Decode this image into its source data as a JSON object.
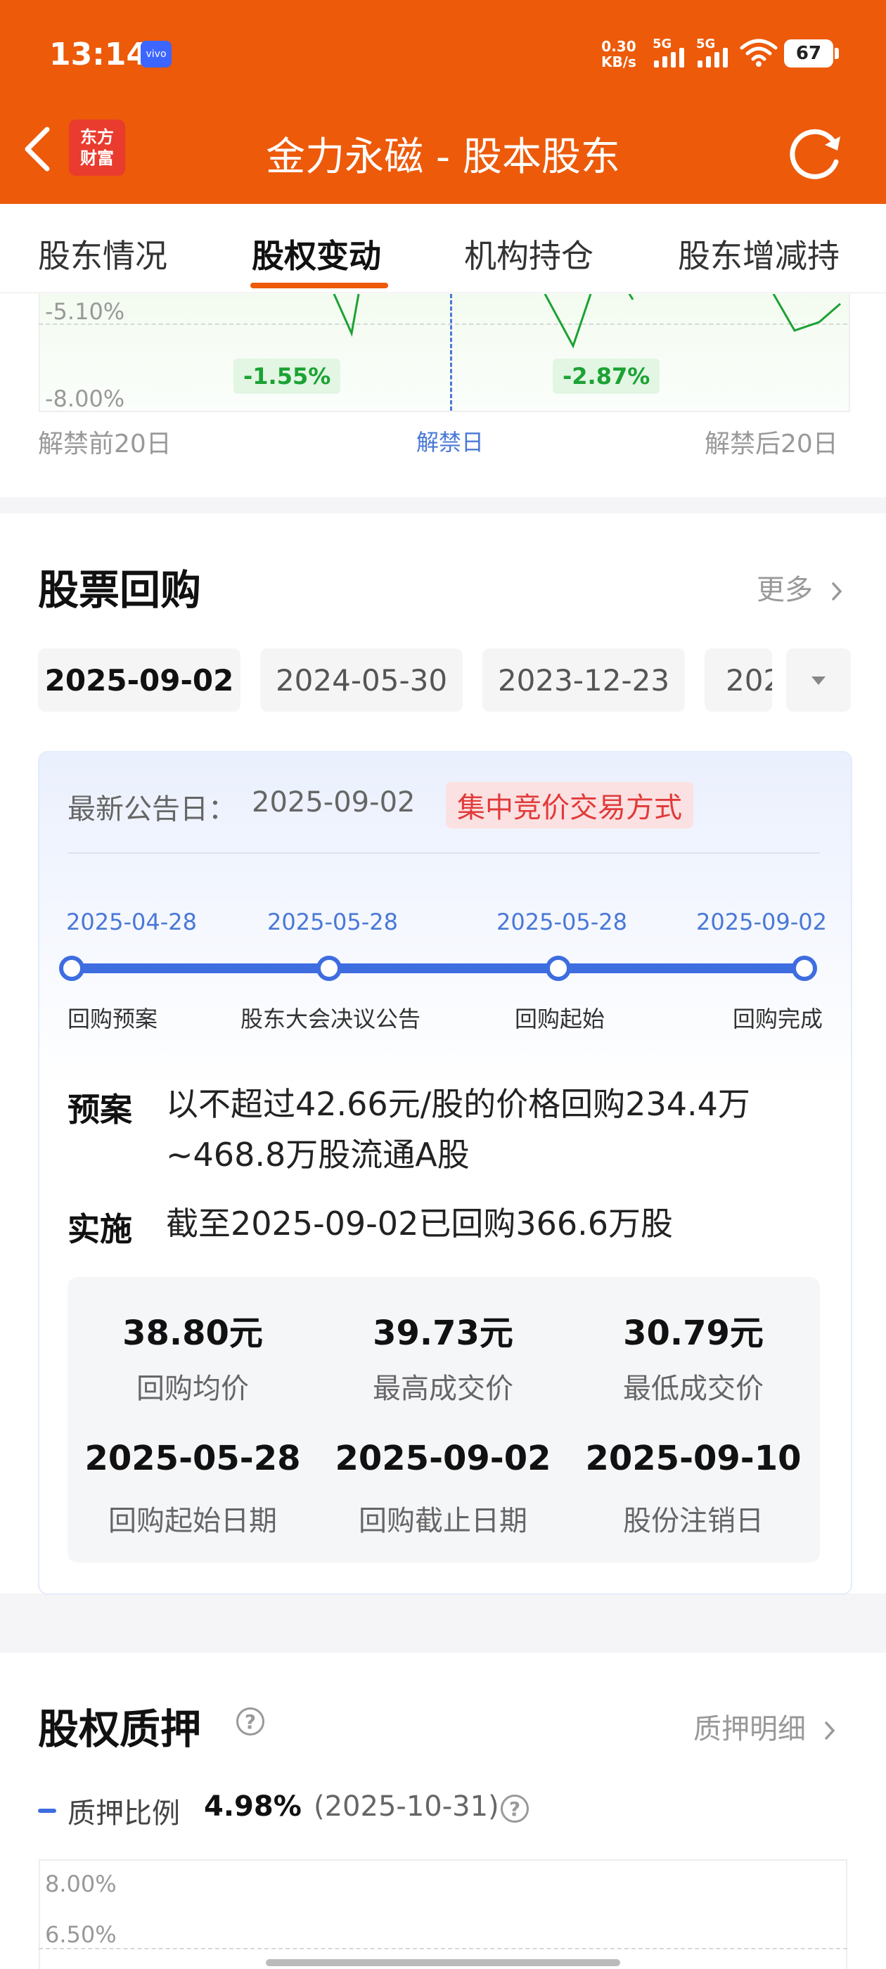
{
  "status_bar": {
    "time": "13:14",
    "carrier_badge": "vivo",
    "net_speed_value": "0.30",
    "net_speed_unit": "KB/s",
    "signal1": "5G",
    "signal2": "5G",
    "battery": "67"
  },
  "header": {
    "logo_line1": "东方",
    "logo_line2": "财富",
    "title": "金力永磁 - 股本股东"
  },
  "tabs": [
    {
      "label": "股东情况"
    },
    {
      "label": "股权变动"
    },
    {
      "label": "机构持仓"
    },
    {
      "label": "股东增减持"
    }
  ],
  "unlock_chart": {
    "y_ticks": [
      "-5.10%",
      "-8.00%"
    ],
    "badge_before": "-1.55%",
    "badge_after": "-2.87%",
    "x_left": "解禁前20日",
    "x_mid": "解禁日",
    "x_right": "解禁后20日",
    "line_color": "#1ca234"
  },
  "buyback": {
    "title": "股票回购",
    "more": "更多",
    "dates": [
      "2025-09-02",
      "2024-05-30",
      "2023-12-23",
      "202"
    ],
    "announce_label": "最新公告日：",
    "announce_date": "2025-09-02",
    "method": "集中竞价交易方式",
    "timeline": [
      {
        "date": "2025-04-28",
        "label": "回购预案"
      },
      {
        "date": "2025-05-28",
        "label": "股东大会决议公告"
      },
      {
        "date": "2025-05-28",
        "label": "回购起始"
      },
      {
        "date": "2025-09-02",
        "label": "回购完成"
      }
    ],
    "plan_key": "预案",
    "plan_text": "以不超过42.66元/股的价格回购234.4万~468.8万股流通A股",
    "impl_key": "实施",
    "impl_text": "截至2025-09-02已回购366.6万股",
    "stats": [
      {
        "value": "38.80元",
        "label": "回购均价"
      },
      {
        "value": "39.73元",
        "label": "最高成交价"
      },
      {
        "value": "30.79元",
        "label": "最低成交价"
      },
      {
        "value": "2025-05-28",
        "label": "回购起始日期"
      },
      {
        "value": "2025-09-02",
        "label": "回购截止日期"
      },
      {
        "value": "2025-09-10",
        "label": "股份注销日"
      }
    ],
    "accent_color": "#3e6de0"
  },
  "pledge": {
    "title": "股权质押",
    "detail_link": "质押明细",
    "legend_label": "质押比例",
    "legend_value": "4.98%",
    "legend_date": "(2025-10-31)",
    "y_ticks": [
      "8.00%",
      "6.50%"
    ]
  }
}
